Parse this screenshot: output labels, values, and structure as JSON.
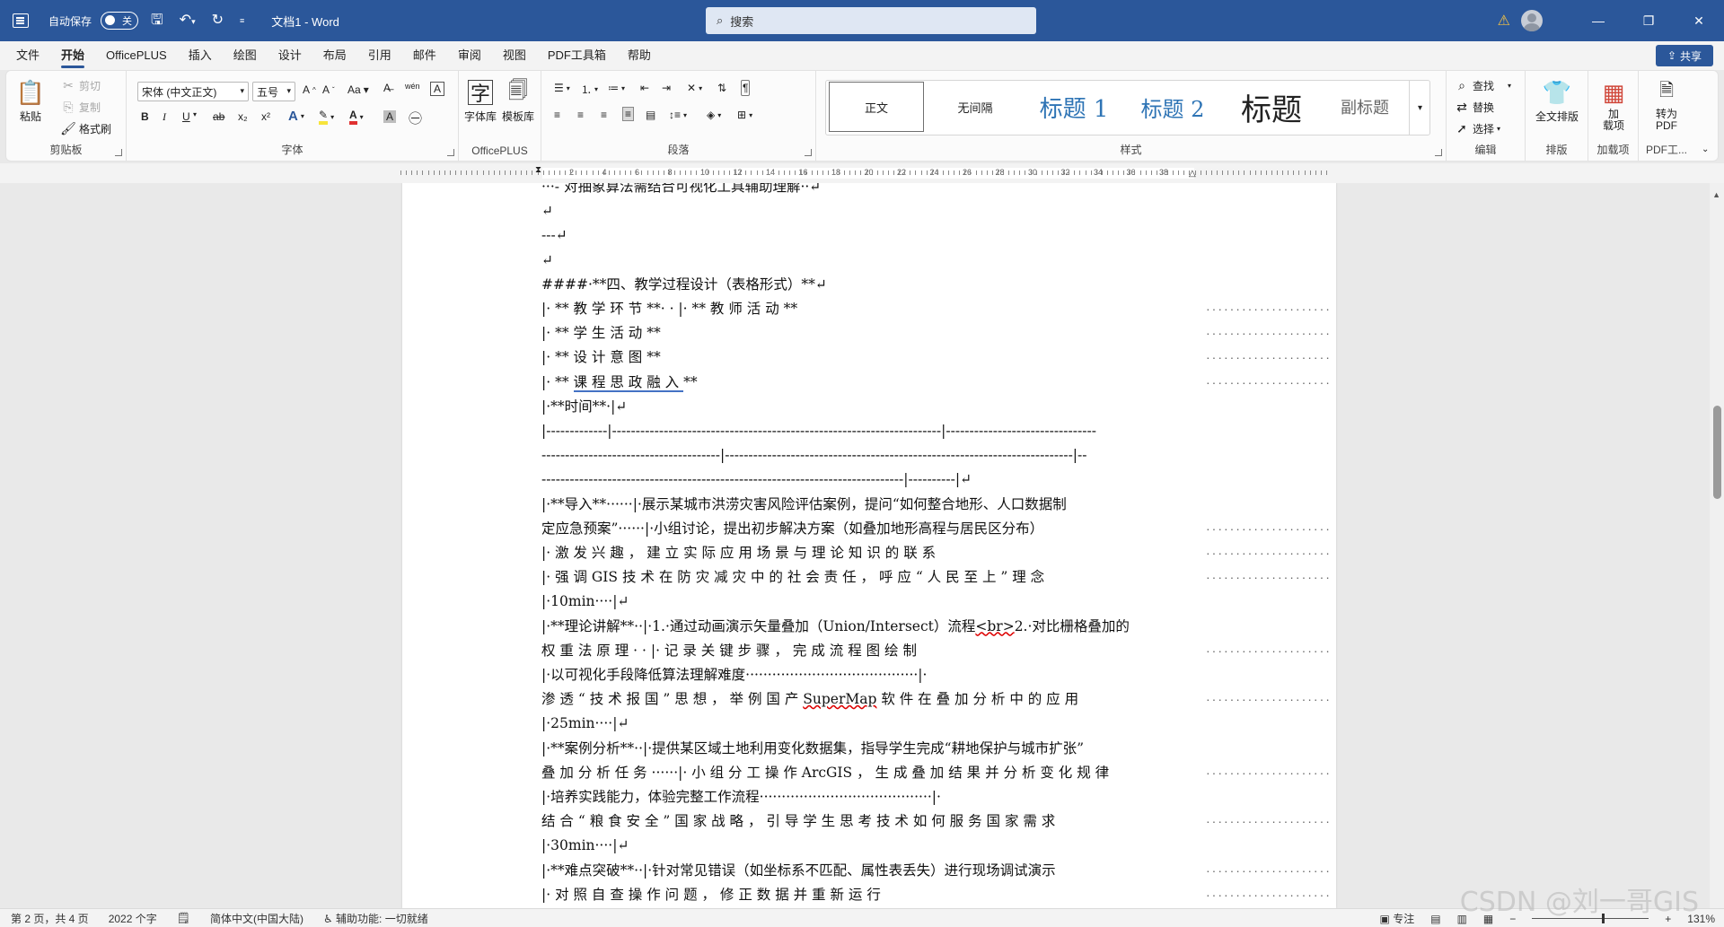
{
  "titlebar": {
    "autosave_label": "自动保存",
    "toggle_state": "关",
    "doc_title": "文档1  -  Word",
    "search_placeholder": "搜索",
    "minimize": "—",
    "restore": "❐",
    "close": "✕"
  },
  "menu": {
    "tabs": [
      "文件",
      "开始",
      "OfficePLUS",
      "插入",
      "绘图",
      "设计",
      "布局",
      "引用",
      "邮件",
      "审阅",
      "视图",
      "PDF工具箱",
      "帮助"
    ],
    "active": "开始",
    "share_label": "共享"
  },
  "ribbon": {
    "clipboard": {
      "paste": "粘贴",
      "cut": "剪切",
      "copy": "复制",
      "format_painter": "格式刷",
      "label": "剪贴板"
    },
    "font": {
      "font_name": "宋体 (中文正文)",
      "font_size": "五号",
      "label": "字体",
      "case": "Aa",
      "bold": "B",
      "italic": "I",
      "underline": "U",
      "strike": "ab",
      "sub": "x₂",
      "sup": "x²"
    },
    "officeplus": {
      "font_lib": "字体库",
      "template_lib": "模板库",
      "label": "OfficePLUS"
    },
    "paragraph": {
      "label": "段落"
    },
    "styles": {
      "items": [
        "正文",
        "无间隔",
        "标题 1",
        "标题 2",
        "标题",
        "副标题"
      ],
      "label": "样式"
    },
    "editing": {
      "find": "查找",
      "replace": "替换",
      "select": "选择",
      "label": "编辑"
    },
    "layout": {
      "full_layout": "全文排版",
      "label": "排版"
    },
    "addins": {
      "addin": "加\n载项",
      "label": "加载项"
    },
    "pdf": {
      "convert": "转为\nPDF",
      "label": "PDF工..."
    },
    "colors": {
      "accent": "#2b579a",
      "highlight": "#f7e43b",
      "font_color": "#e03131"
    }
  },
  "ruler": {
    "numbers": [
      "2",
      "4",
      "6",
      "8",
      "10",
      "12",
      "14",
      "16",
      "18",
      "20",
      "22",
      "24",
      "26",
      "28",
      "30",
      "32",
      "34",
      "36",
      "38"
    ]
  },
  "document": {
    "lines": [
      "···- 对抽象算法需结合可视化工具辅助理解··↵",
      "↵",
      "---↵",
      "↵",
      "####·**四、教学过程设计（表格形式）**↵",
      "|·  **  教  学  环  节  **·  ·  |·  **  教  师  活  动  **",
      "|·  **  学  生  活  动  **",
      "|·  **  设  计  意  图  **",
      "|·  **  课  程  思  政  融  入  **",
      "|·**时间**·|↵",
      "|-------------|----------------------------------------------------------------------|--------------------------------",
      "--------------------------------------|--------------------------------------------------------------------------|--",
      "-----------------------------------------------------------------------------|----------|↵",
      "|·**导入**······|·展示某城市洪涝灾害风险评估案例，提问“如何整合地形、人口数据制",
      "定应急预案”······|·小组讨论，提出初步解决方案（如叠加地形高程与居民区分布）",
      "|·  激  发  兴  趣  ，  建  立  实  际  应  用  场  景  与  理  论  知  识  的  联  系",
      "|·  强  调  GIS  技  术  在  防  灾  减  灾  中  的  社  会  责  任  ，  呼  应  “  人  民  至  上  ”  理  念",
      "|·10min····|↵",
      "|·**理论讲解**··|·1.·通过动画演示矢量叠加（Union/Intersect）流程<br>2.·对比栅格叠加的",
      "权  重  法  原  理  ·  ·  |·  记  录  关  键  步  骤  ，  完  成  流  程  图  绘  制",
      "|·以可视化手段降低算法理解难度·······································|·",
      "渗  透  “  技  术  报  国  ”  思  想  ，  举  例  国  产  SuperMap  软  件  在  叠  加  分  析  中  的  应  用",
      "|·25min····|↵",
      "|·**案例分析**··|·提供某区域土地利用变化数据集，指导学生完成“耕地保护与城市扩张”",
      "叠  加  分  析  任  务  ······|·  小  组  分  工  操  作  ArcGIS  ，  生  成  叠  加  结  果  并  分  析  变  化  规  律",
      "|·培养实践能力，体验完整工作流程·······································|·",
      "结  合  “  粮  食  安  全  ”  国  家  战  略  ，  引  导  学  生  思  考  技  术  如  何  服  务  国  家  需  求",
      "|·30min····|↵",
      "|·**难点突破**··|·针对常见错误（如坐标系不匹配、属性表丢失）进行现场调试演示",
      "|·  对  照  自  查  操  作  问  题  ，  修  正  数  据  并  重  新  运  行"
    ],
    "dots": "··························"
  },
  "statusbar": {
    "page": "第 2 页，共 4 页",
    "words": "2022 个字",
    "language": "简体中文(中国大陆)",
    "accessibility": "辅助功能: 一切就绪",
    "focus": "专注",
    "zoom": "131%"
  },
  "watermark": "CSDN @刘一哥GIS"
}
